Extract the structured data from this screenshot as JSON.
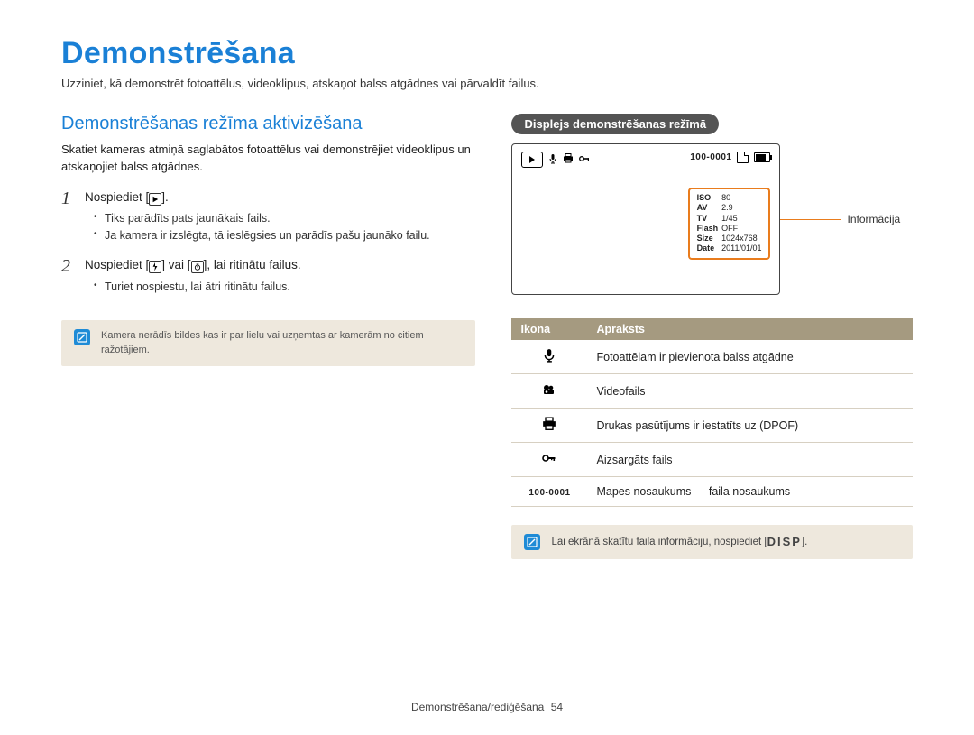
{
  "title": "Demonstrēšana",
  "intro": "Uzziniet, kā demonstrēt fotoattēlus, videoklipus, atskaņot balss atgādnes vai pārvaldīt failus.",
  "left": {
    "section_title": "Demonstrēšanas režīma aktivizēšana",
    "sub_intro": "Skatiet kameras atmiņā saglabātos fotoattēlus vai demonstrējiet videoklipus un atskaņojiet balss atgādnes.",
    "step1": {
      "main_pre": "Nospiediet [",
      "main_post": "].",
      "b1": "Tiks parādīts pats jaunākais fails.",
      "b2": "Ja kamera ir izslēgta, tā ieslēgsies un parādīs pašu jaunāko failu."
    },
    "step2": {
      "main_pre": "Nospiediet [",
      "main_mid": "] vai [",
      "main_post": "], lai ritinātu failus.",
      "b1": "Turiet nospiestu, lai ātri ritinātu failus."
    },
    "note": "Kamera nerādīs bildes kas ir par lielu vai uzņemtas ar kamerām no citiem ražotājiem."
  },
  "right": {
    "heading": "Displejs demonstrēšanas režīmā",
    "file_number": "100-0001",
    "info_label": "Informācija",
    "info": {
      "ISO": "80",
      "AV": "2.9",
      "TV": "1/45",
      "Flash": "OFF",
      "Size": "1024x768",
      "Date": "2011/01/01"
    },
    "table": {
      "h1": "Ikona",
      "h2": "Apraksts",
      "r1": "Fotoattēlam ir pievienota balss atgādne",
      "r2": "Videofails",
      "r3": "Drukas pasūtījums ir iestatīts uz (DPOF)",
      "r4": "Aizsargāts fails",
      "r5_icon": "100-0001",
      "r5": "Mapes nosaukums — faila nosaukums"
    },
    "note_pre": "Lai ekrānā skatītu faila informāciju, nospiediet [",
    "note_badge": "DISP",
    "note_post": "]."
  },
  "footer": {
    "text": "Demonstrēšana/rediģēšana",
    "page": "54"
  }
}
